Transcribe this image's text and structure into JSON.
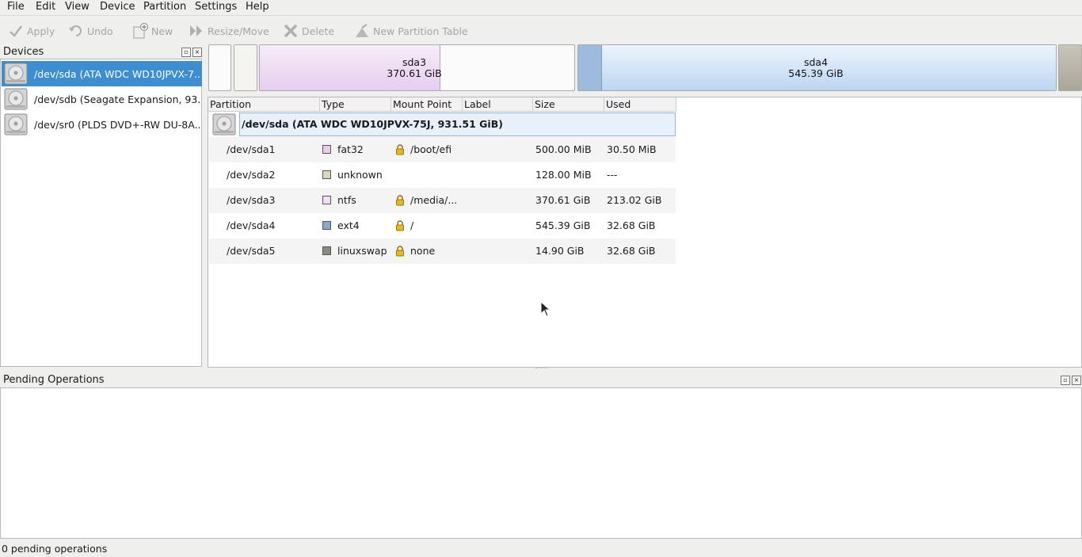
{
  "menu": [
    "File",
    "Edit",
    "View",
    "Device",
    "Partition",
    "Settings",
    "Help"
  ],
  "toolbar": {
    "apply": "Apply",
    "undo": "Undo",
    "new": "New",
    "resize": "Resize/Move",
    "delete": "Delete",
    "new_table": "New Partition Table"
  },
  "devices": {
    "title": "Devices",
    "items": [
      {
        "label": "/dev/sda (ATA WDC WD10JPVX-7..."
      },
      {
        "label": "/dev/sdb (Seagate Expansion, 93..."
      },
      {
        "label": "/dev/sr0 (PLDS DVD+-RW DU-8A..."
      }
    ]
  },
  "partition_bar": {
    "sda3": {
      "name": "sda3",
      "size": "370.61 GiB"
    },
    "sda4": {
      "name": "sda4",
      "size": "545.39 GiB"
    }
  },
  "table": {
    "headers": [
      "Partition",
      "Type",
      "Mount Point",
      "Label",
      "Size",
      "Used"
    ],
    "disk": "/dev/sda (ATA WDC WD10JPVX-75J, 931.51 GiB)",
    "rows": [
      {
        "partition": "/dev/sda1",
        "type": "fat32",
        "color": "#f0c8f0",
        "mount": "/boot/efi",
        "label": "",
        "size": "500.00 MiB",
        "used": "30.50 MiB",
        "locked": true
      },
      {
        "partition": "/dev/sda2",
        "type": "unknown",
        "color": "#dcd8bc",
        "mount": "",
        "label": "",
        "size": "128.00 MiB",
        "used": "---",
        "locked": false
      },
      {
        "partition": "/dev/sda3",
        "type": "ntfs",
        "color": "#f2dcf6",
        "mount": "/media/...",
        "label": "",
        "size": "370.61 GiB",
        "used": "213.02 GiB",
        "locked": true
      },
      {
        "partition": "/dev/sda4",
        "type": "ext4",
        "color": "#88a8cc",
        "mount": "/",
        "label": "",
        "size": "545.39 GiB",
        "used": "32.68 GiB",
        "locked": true
      },
      {
        "partition": "/dev/sda5",
        "type": "linuxswap",
        "color": "#8a8a80",
        "mount": "none",
        "label": "",
        "size": "14.90 GiB",
        "used": "32.68 GiB",
        "locked": true
      }
    ]
  },
  "pending": {
    "title": "Pending Operations"
  },
  "status": "0 pending operations"
}
